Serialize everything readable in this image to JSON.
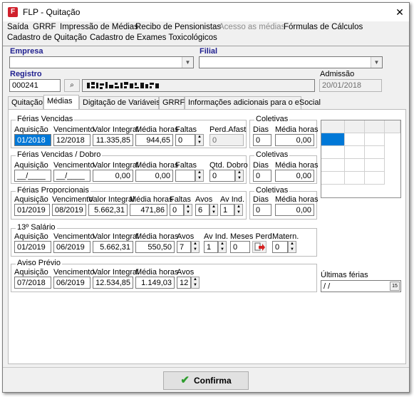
{
  "window": {
    "title": "FLP - Quitação",
    "icon_letter": "F",
    "close_glyph": "✕"
  },
  "menu": {
    "row1": [
      "Saída",
      "GRRF",
      "Impressão de Médias",
      "Recibo de Pensionistas",
      "Acesso as médias",
      "Fórmulas de Cálculos"
    ],
    "row2": [
      "Cadastro de Quitação",
      "Cadastro de Exames Toxicológicos"
    ]
  },
  "header": {
    "empresa_label": "Empresa",
    "filial_label": "Filial",
    "registro_label": "Registro",
    "registro_value": "000241",
    "admissao_label": "Admissão",
    "admissao_value": "20/01/2018"
  },
  "tabs": [
    "Quitação",
    "Médias",
    "Digitação de Variáveis",
    "GRRF",
    "Informações adicionais para o eSocial"
  ],
  "ferias_vencidas": {
    "title": "Férias Vencidas",
    "labels": [
      "Aquisição",
      "Vencimento",
      "Valor Integral",
      "Média horas",
      "Faltas",
      "Perd.Afast"
    ],
    "aquisicao": "01/2018",
    "vencimento": "12/2018",
    "valor_integral": "11.335,85",
    "media_horas": "944,65",
    "faltas": "0",
    "perd_afast": "0"
  },
  "coletivas_1": {
    "title": "Coletivas",
    "labels": [
      "Dias",
      "Média horas"
    ],
    "dias": "0",
    "media_horas": "0,00"
  },
  "ferias_vencidas_dobro": {
    "title": "Férias Vencidas / Dobro",
    "labels": [
      "Aquisição",
      "Vencimento",
      "Valor Integral",
      "Média horas",
      "Faltas",
      "Qtd. Dobro"
    ],
    "aquisicao": "__/____",
    "vencimento": "__/____",
    "valor_integral": "0,00",
    "media_horas": "0,00",
    "faltas": "",
    "qtd_dobro": "0"
  },
  "coletivas_2": {
    "title": "Coletivas",
    "labels": [
      "Dias",
      "Média horas"
    ],
    "dias": "0",
    "media_horas": "0,00"
  },
  "ferias_proporcionais": {
    "title": "Férias Proporcionais",
    "labels": [
      "Aquisição",
      "Vencimento",
      "Valor Integral",
      "Média horas",
      "Faltas",
      "Avos",
      "Av Ind."
    ],
    "aquisicao": "01/2019",
    "vencimento": "08/2019",
    "valor_integral": "5.662,31",
    "media_horas": "471,86",
    "faltas": "0",
    "avos": "6",
    "av_ind": "1"
  },
  "coletivas_3": {
    "title": "Coletivas",
    "labels": [
      "Dias",
      "Média horas"
    ],
    "dias": "0",
    "media_horas": "0,00"
  },
  "decimo_terceiro": {
    "title": "13º Salário",
    "labels": [
      "Aquisição",
      "Vencimento",
      "Valor Integral",
      "Média horas",
      "Avos",
      "Av Ind.",
      "Meses Perd.",
      "Matern."
    ],
    "aquisicao": "01/2019",
    "vencimento": "06/2019",
    "valor_integral": "5.662,31",
    "media_horas": "550,50",
    "avos": "7",
    "av_ind": "1",
    "meses_perd": "0",
    "matern": "0"
  },
  "aviso_previo": {
    "title": "Aviso Prévio",
    "labels": [
      "Aquisição",
      "Vencimento",
      "Valor Integral",
      "Média horas",
      "Avos"
    ],
    "aquisicao": "07/2018",
    "vencimento": "06/2019",
    "valor_integral": "12.534,85",
    "media_horas": "1.149,03",
    "avos": "12"
  },
  "ultimas_ferias": {
    "label": "Últimas férias",
    "value": " / /"
  },
  "footer": {
    "confirm_label": "Confirma",
    "check_glyph": "✔"
  },
  "colors": {
    "selection": "#0078d7",
    "label_blue": "#1f1f8f",
    "confirm_green": "#2e9d2e"
  }
}
